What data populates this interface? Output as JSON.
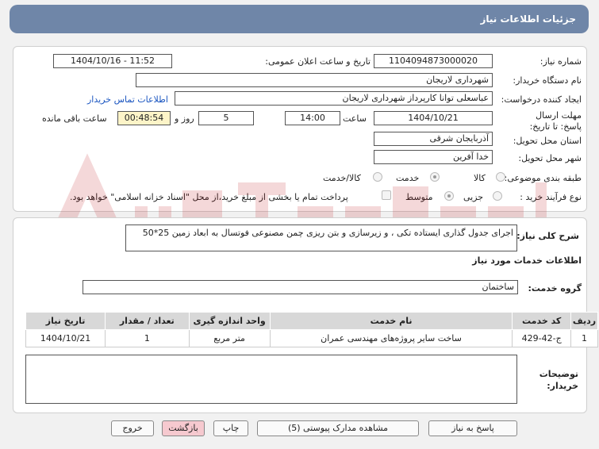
{
  "header": {
    "title": "جزئیات اطلاعات نیاز"
  },
  "form": {
    "need_number_label": "شماره نیاز:",
    "need_number": "1104094873000020",
    "announce_label": "تاریخ و ساعت اعلان عمومی:",
    "announce_value": "1404/10/16 - 11:52",
    "buyer_org_label": "نام دستگاه خریدار:",
    "buyer_org": "شهرداری لاریجان",
    "creator_label": "ایجاد کننده درخواست:",
    "creator": "عباسعلی توانا کارپرداز شهرداری لاریجان",
    "contact_link": "اطلاعات تماس خریدار",
    "deadline_label": "مهلت ارسال پاسخ: تا تاریخ:",
    "deadline_date": "1404/10/21",
    "time_label": "ساعت",
    "deadline_time": "14:00",
    "days_value": "5",
    "days_label": "روز و",
    "remaining_value": "00:48:54",
    "remaining_label": "ساعت باقی مانده",
    "province_label": "استان محل تحویل:",
    "province": "آذربایجان شرقی",
    "city_label": "شهر محل تحویل:",
    "city": "خدا آفرین",
    "category_label": "طبقه بندی موضوعی:",
    "category_options": [
      "کالا",
      "خدمت",
      "کالا/خدمت"
    ],
    "process_label": "نوع فرآیند خرید :",
    "process_options": [
      "جزیی",
      "متوسط"
    ],
    "payment_note": "پرداخت تمام یا بخشی از مبلغ خرید،از محل \"اسناد خزانه اسلامی\" خواهد بود."
  },
  "description": {
    "label": "شرح کلی نیاز:",
    "text": "اجرای جدول گذاری  ایستاده تکی ، و زیرسازی و بتن ریزی چمن مصنوعی فوتسال به ابعاد زمین 25*50"
  },
  "services": {
    "section_title": "اطلاعات خدمات مورد نیاز",
    "group_label": "گروه خدمت:",
    "group_value": "ساختمان",
    "columns": [
      "ردیف",
      "کد خدمت",
      "نام خدمت",
      "واحد اندازه گیری",
      "تعداد / مقدار",
      "تاریخ نیاز"
    ],
    "rows": [
      [
        "1",
        "ج-42-429",
        "ساخت سایر پروژه‌های مهندسی عمران",
        "متر مربع",
        "1",
        "1404/10/21"
      ]
    ]
  },
  "buyer_notes": {
    "label": "توضیحات خریدار:",
    "text": ""
  },
  "buttons": {
    "reply": "پاسخ به نیاز",
    "attachments": "مشاهده مدارک پیوستی (5)",
    "print": "چاپ",
    "back": "بازگشت",
    "exit": "خروج"
  },
  "colors": {
    "header_bg": "#6f86a8",
    "link": "#1a55c0",
    "remaining_bg": "#fdf4c8",
    "back_bg": "#f6c9cf"
  }
}
